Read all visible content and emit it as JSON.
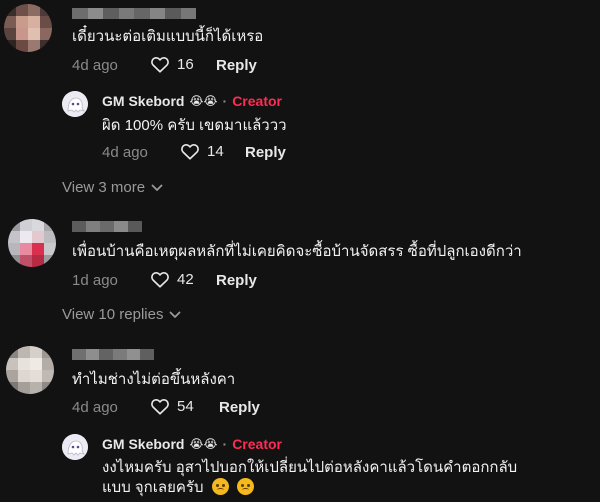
{
  "comments": [
    {
      "text": "เดี๋ยวนะต่อเติมแบบนี้ก็ได้เหรอ",
      "time": "4d ago",
      "likes": "16",
      "reply_label": "Reply",
      "reply": {
        "username": "GM Skebord",
        "emoji": "😭😭",
        "separator": "·",
        "badge": "Creator",
        "text": "ผิด 100% ครับ เขดมาแล้ววว",
        "time": "4d ago",
        "likes": "14",
        "reply_label": "Reply"
      },
      "view_more": "View 3 more"
    },
    {
      "text": "เพื่อนบ้านคือเหตุผลหลักที่ไม่เคยคิดจะซื้อบ้านจัดสรร ซื้อที่ปลูกเองดีกว่า",
      "time": "1d ago",
      "likes": "42",
      "reply_label": "Reply",
      "view_more": "View 10 replies"
    },
    {
      "text": "ทำไมช่างไม่ต่อขึ้นหลังคา",
      "time": "4d ago",
      "likes": "54",
      "reply_label": "Reply",
      "reply": {
        "username": "GM Skebord",
        "emoji": "😭😭",
        "separator": "·",
        "badge": "Creator",
        "text_line1": "งงไหมครับ อุสาไปบอกให้เปลี่ยนไปต่อหลังคาแล้วโดนคำตอกกลับ",
        "text_line2": "แบบ จุกเลยครับ"
      }
    }
  ],
  "colors": {
    "background": "#121212",
    "creator": "#fe2c55",
    "muted": "#8a8a8a"
  },
  "icons": {
    "like": "heart-outline-icon",
    "expand": "chevron-down-icon",
    "emoji_sad": "sad-face-icon"
  }
}
